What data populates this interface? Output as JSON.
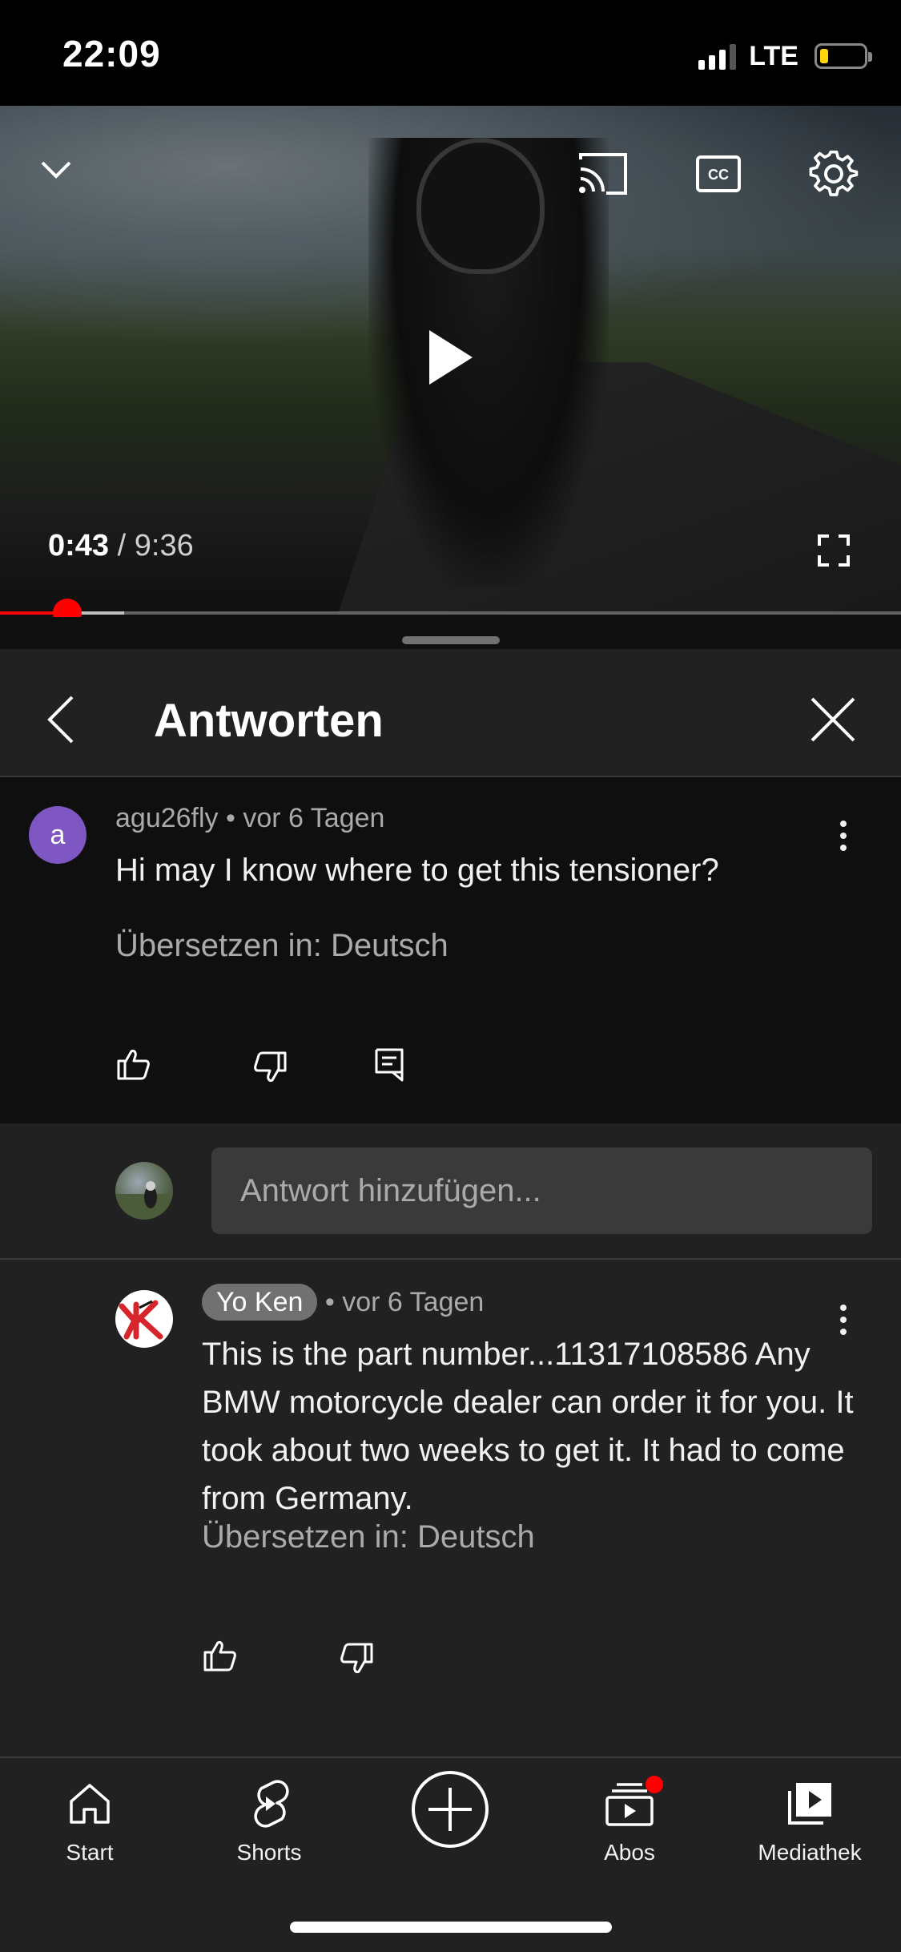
{
  "status_bar": {
    "time": "22:09",
    "network": "LTE"
  },
  "video": {
    "current_time": "0:43",
    "separator": " / ",
    "duration": "9:36",
    "progress_fraction": 0.075
  },
  "panel": {
    "title": "Antworten",
    "comment": {
      "avatar_letter": "a",
      "avatar_color": "#7e57c2",
      "author": "agu26fly",
      "age": "vor 6 Tagen",
      "text": "Hi may I know where to get this tensioner?",
      "translate": "Übersetzen in: Deutsch"
    },
    "reply_input": {
      "placeholder": "Antwort hinzufügen..."
    },
    "reply": {
      "author": "Yo Ken",
      "age": "vor 6 Tagen",
      "text": "This is the part number...11317108586 Any BMW motorcycle dealer can order it for you. It took about two weeks to get it. It had to come from Germany.",
      "translate": "Übersetzen in: Deutsch"
    }
  },
  "nav": {
    "items": [
      {
        "label": "Start",
        "icon": "home-icon"
      },
      {
        "label": "Shorts",
        "icon": "shorts-icon"
      },
      {
        "label": "",
        "icon": "create-plus-icon"
      },
      {
        "label": "Abos",
        "icon": "subscriptions-icon"
      },
      {
        "label": "Mediathek",
        "icon": "library-icon"
      }
    ]
  },
  "colors": {
    "accent": "#ff0000",
    "background": "#0f0f0f",
    "surface": "#212121"
  }
}
